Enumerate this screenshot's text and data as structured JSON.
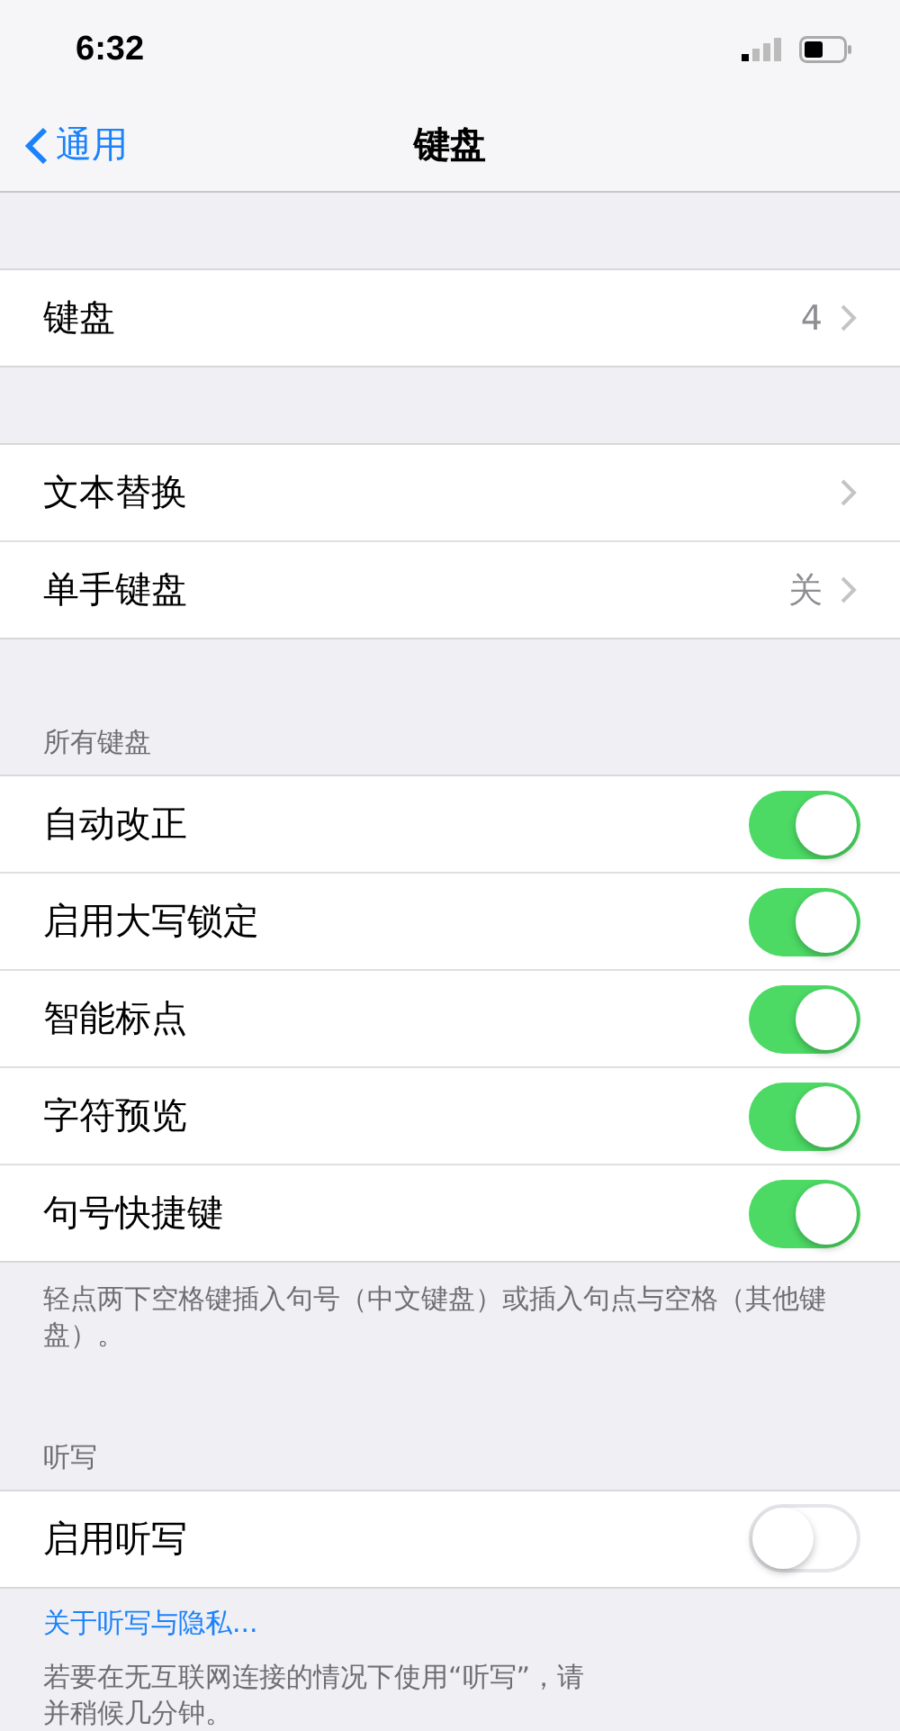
{
  "status_bar": {
    "time": "6:32"
  },
  "nav": {
    "back": "通用",
    "title": "键盘"
  },
  "groups": [
    {
      "rows": [
        {
          "kind": "link",
          "label": "键盘",
          "value": "4"
        }
      ]
    },
    {
      "rows": [
        {
          "kind": "link",
          "label": "文本替换"
        },
        {
          "kind": "link",
          "label": "单手键盘",
          "value": "关"
        }
      ]
    },
    {
      "header": "所有键盘",
      "rows": [
        {
          "kind": "toggle",
          "label": "自动改正",
          "on": true
        },
        {
          "kind": "toggle",
          "label": "启用大写锁定",
          "on": true
        },
        {
          "kind": "toggle",
          "label": "智能标点",
          "on": true
        },
        {
          "kind": "toggle",
          "label": "字符预览",
          "on": true
        },
        {
          "kind": "toggle",
          "label": "句号快捷键",
          "on": true
        }
      ],
      "footer": [
        "轻点两下空格键插入句号（中文键盘）或插入句点与空格（其他键盘）。"
      ]
    },
    {
      "header": "听写",
      "rows": [
        {
          "kind": "toggle",
          "label": "启用听写",
          "on": false
        }
      ],
      "link": "关于听写与隐私...",
      "footer": [
        "若要在无互联网连接的情况下使用“听写”，请",
        "并稍候几分钟。"
      ]
    }
  ]
}
